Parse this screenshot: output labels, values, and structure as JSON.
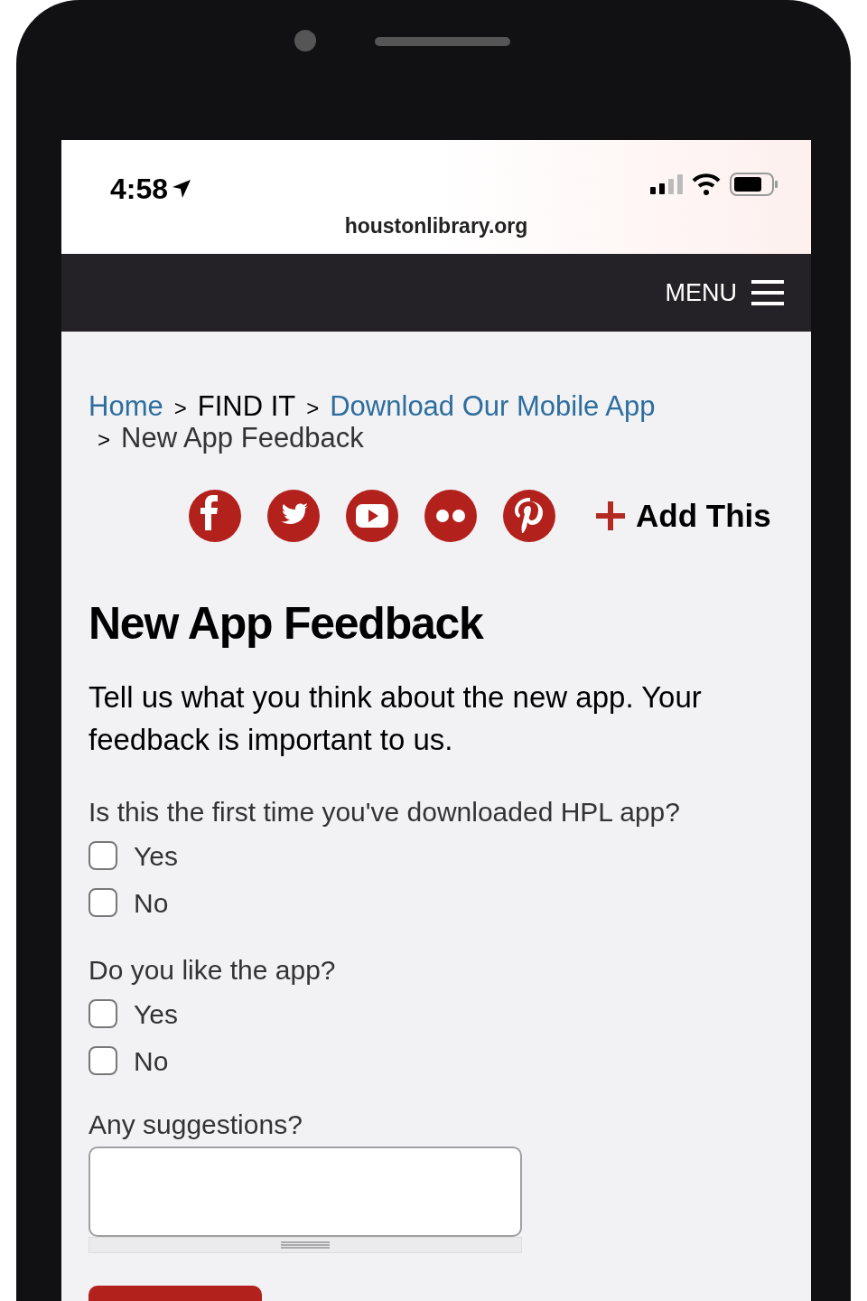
{
  "status_bar": {
    "time": "4:58",
    "url": "houstonlibrary.org"
  },
  "navbar": {
    "menu_label": "MENU"
  },
  "breadcrumb": [
    {
      "label": "Home",
      "kind": "link"
    },
    {
      "label": "FIND IT",
      "kind": "plain"
    },
    {
      "label": "Download Our Mobile App",
      "kind": "link"
    },
    {
      "label": "New App Feedback",
      "kind": "plain"
    }
  ],
  "breadcrumb_separator": ">",
  "share": {
    "networks": [
      {
        "kind": "facebook"
      },
      {
        "kind": "twitter"
      },
      {
        "kind": "youtube"
      },
      {
        "kind": "flickr"
      },
      {
        "kind": "pinterest"
      }
    ],
    "add_label": "Add This"
  },
  "heading": "New App Feedback",
  "intro": "Tell us what you think about the new app. Your feedback is important to us.",
  "questions": [
    {
      "label": "Is this the first time you've downloaded HPL app?",
      "options": [
        {
          "label": "Yes",
          "checked": false
        },
        {
          "label": "No",
          "checked": false
        }
      ]
    },
    {
      "label": "Do you like the app?",
      "options": [
        {
          "label": "Yes",
          "checked": false
        },
        {
          "label": "No",
          "checked": false
        }
      ]
    }
  ],
  "suggestions": {
    "label": "Any suggestions?"
  }
}
